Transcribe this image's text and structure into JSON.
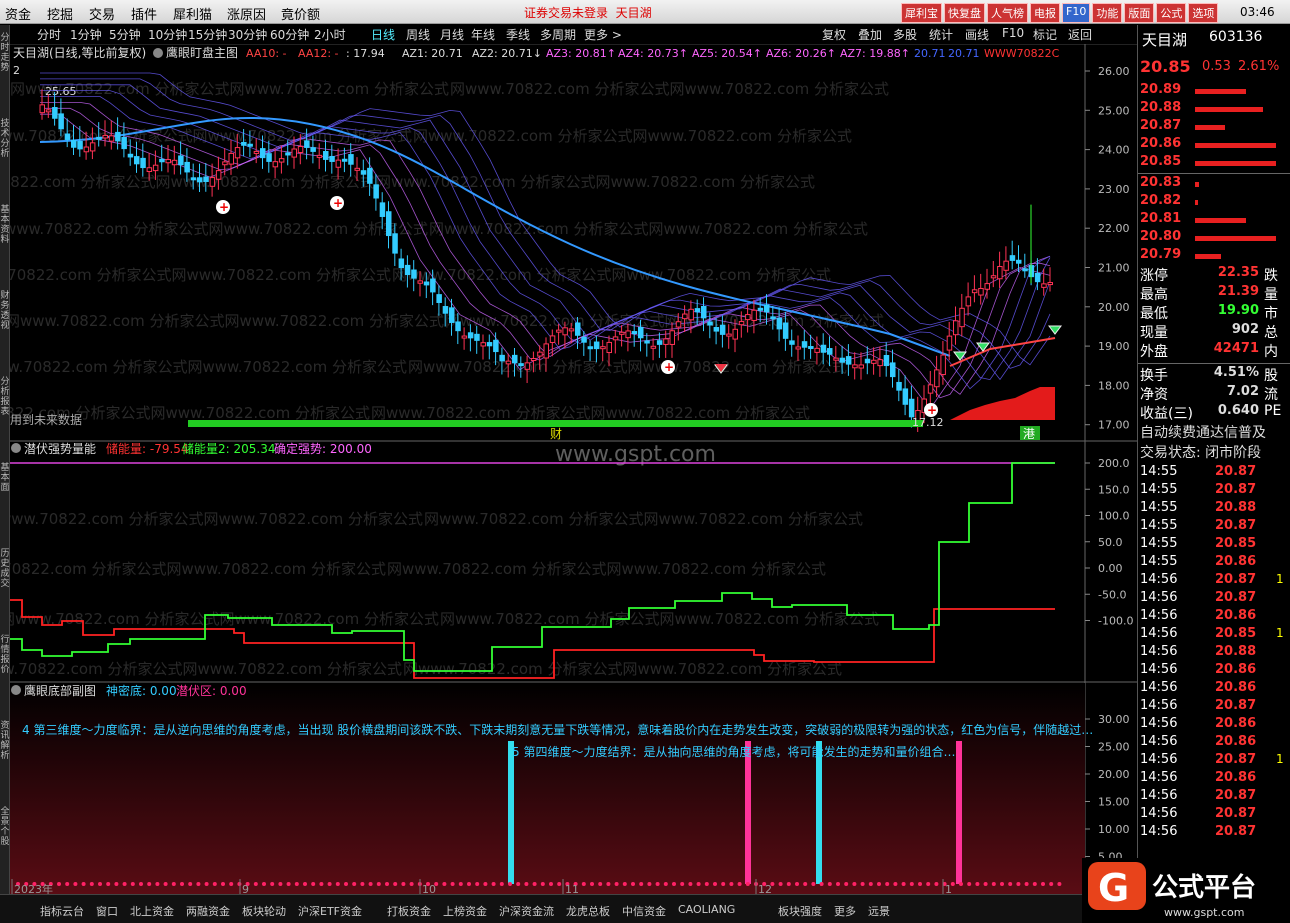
{
  "menu": {
    "items": [
      "资金",
      "挖掘",
      "交易",
      "插件",
      "犀利猫",
      "涨原因",
      "竟价额"
    ],
    "login_status": "证券交易未登录",
    "stock_tag": "天目湖",
    "clock": "03:46"
  },
  "toolbar_buttons": [
    {
      "label": "犀利宝",
      "color": "#cc3333"
    },
    {
      "label": "快复盘",
      "color": "#cc3333"
    },
    {
      "label": "人气榜",
      "color": "#cc3333"
    },
    {
      "label": "电报",
      "color": "#cc3333"
    },
    {
      "label": "F10",
      "color": "#3366cc"
    },
    {
      "label": "功能",
      "color": "#cc3333"
    },
    {
      "label": "版面",
      "color": "#cc3333"
    },
    {
      "label": "公式",
      "color": "#cc3333"
    },
    {
      "label": "选项",
      "color": "#cc3333"
    }
  ],
  "left_nav": [
    "分时走势",
    "技术分析",
    "基本资料",
    "财务透视",
    "分析报表",
    "基本面",
    "历史成交",
    "行情报价",
    "资讯解析",
    "全景个股"
  ],
  "periods": [
    "分时",
    "1分钟",
    "5分钟",
    "10分钟",
    "15分钟",
    "30分钟",
    "60分钟",
    "2小时",
    "日线",
    "周线",
    "月线",
    "年线",
    "季线",
    "多周期",
    "更多 >"
  ],
  "active_period": "日线",
  "right_tools": [
    "复权",
    "叠加",
    "多股",
    "统计",
    "画线",
    "F10",
    "标记",
    "返回"
  ],
  "main_chart": {
    "stock_title": "天目湖(日线,等比前复权)",
    "formula_name": "鹰眼盯盘主图",
    "indicators": [
      {
        "text": "AA10: -",
        "color": "#ff4444"
      },
      {
        "text": "AA12: -",
        "color": "#ff4444"
      },
      {
        "text": ": 17.94",
        "color": "#dddddd"
      },
      {
        "text": "AZ1: 20.71",
        "color": "#dddddd"
      },
      {
        "text": "AZ2: 20.71↓",
        "color": "#dddddd"
      },
      {
        "text": "AZ3: 20.81↑",
        "color": "#ff66ff"
      },
      {
        "text": "AZ4: 20.73↑",
        "color": "#ff66ff"
      },
      {
        "text": "AZ5: 20.54↑",
        "color": "#ff66ff"
      },
      {
        "text": "AZ6: 20.26↑",
        "color": "#ff66ff"
      },
      {
        "text": "AZ7: 19.88↑",
        "color": "#ff66ff"
      },
      {
        "text": "20.71",
        "color": "#4466ff"
      },
      {
        "text": "20.71",
        "color": "#4466ff"
      },
      {
        "text": "WWW70822C",
        "color": "#ff3333"
      }
    ],
    "y_ticks": [
      "26.00",
      "25.00",
      "24.00",
      "23.00",
      "22.00",
      "21.00",
      "20.00",
      "19.00",
      "18.00",
      "17.00"
    ],
    "high_label": "25.65",
    "low_label": "17.12",
    "counter_label": "2",
    "no_future_label": "用到未来数据",
    "marker_cai": "财",
    "marker_gang": "港",
    "watermark": "网www.70822.com 分析家公式网www.70822.com 分析家公式"
  },
  "indicator1": {
    "name": "潜伏强势量能",
    "values": [
      {
        "text": "储能量: -79.54",
        "color": "#ff3333"
      },
      {
        "text": "储能量2: 205.34",
        "color": "#33ff33"
      },
      {
        "text": "确定强势: 200.00",
        "color": "#ff66ff"
      }
    ],
    "y_ticks": [
      "200.0",
      "150.0",
      "100.0",
      "50.0",
      "0.00",
      "-50.0",
      "-100.0"
    ],
    "site_watermark": "www.gspt.com"
  },
  "indicator2": {
    "name": "鹰眼底部副图",
    "values": [
      {
        "text": "神密底: 0.00",
        "color": "#33ccff"
      },
      {
        "text": "潜伏区: 0.00",
        "color": "#ff3399"
      }
    ],
    "note1": "4 第三维度～力度临界：是从逆向思维的角度考虑，当出现 股价横盘期间该跌不跌、下跌末期刻意无量下跌等情况，意味着股价内在走势发生改变，突破弱的极限转为强的状态，红色为信号，伴随越过…",
    "note2": "5 第四维度～力度结界：是从抽向思维的角度考虑，将可能发生的走势和量价组合…",
    "y_ticks": [
      "30.00",
      "25.00",
      "20.00",
      "15.00",
      "10.00",
      "5.00"
    ],
    "date_labels": [
      "2023年",
      "9",
      "10",
      "11",
      "12",
      "1"
    ]
  },
  "quote": {
    "name": "天目湖",
    "code": "603136",
    "price": "20.85",
    "change": "0.53",
    "pct": "2.61%",
    "asks": [
      {
        "p": "20.89",
        "w": 0.6
      },
      {
        "p": "20.88",
        "w": 0.8
      },
      {
        "p": "20.87",
        "w": 0.35
      },
      {
        "p": "20.86",
        "w": 0.95
      },
      {
        "p": "20.85",
        "w": 0.95
      }
    ],
    "bids": [
      {
        "p": "20.83",
        "w": 0.05
      },
      {
        "p": "20.82",
        "w": 0.04
      },
      {
        "p": "20.81",
        "w": 0.6
      },
      {
        "p": "20.80",
        "w": 0.95
      },
      {
        "p": "20.79",
        "w": 0.3
      }
    ],
    "stats": [
      {
        "label": "涨停",
        "value": "22.35",
        "color": "#ff3333",
        "extra": "跌"
      },
      {
        "label": "最高",
        "value": "21.39",
        "color": "#ff3333",
        "extra": "量"
      },
      {
        "label": "最低",
        "value": "19.90",
        "color": "#33ff33",
        "extra": "市"
      },
      {
        "label": "现量",
        "value": "902",
        "color": "#dddddd",
        "extra": "总"
      },
      {
        "label": "外盘",
        "value": "42471",
        "color": "#ff3333",
        "extra": "内"
      },
      {
        "label": "换手",
        "value": "4.51%",
        "color": "#dddddd",
        "extra": "股"
      },
      {
        "label": "净资",
        "value": "7.02",
        "color": "#dddddd",
        "extra": "流"
      },
      {
        "label": "收益(三)",
        "value": "0.640",
        "color": "#dddddd",
        "extra": "PE"
      }
    ],
    "notice": "自动续费通达信普及",
    "trade_state": "交易状态: 闭市阶段",
    "ticks": [
      {
        "t": "14:55",
        "p": "20.87",
        "v": ""
      },
      {
        "t": "14:55",
        "p": "20.87",
        "v": ""
      },
      {
        "t": "14:55",
        "p": "20.88",
        "v": ""
      },
      {
        "t": "14:55",
        "p": "20.87",
        "v": ""
      },
      {
        "t": "14:55",
        "p": "20.85",
        "v": ""
      },
      {
        "t": "14:55",
        "p": "20.86",
        "v": ""
      },
      {
        "t": "14:56",
        "p": "20.87",
        "v": "1"
      },
      {
        "t": "14:56",
        "p": "20.87",
        "v": ""
      },
      {
        "t": "14:56",
        "p": "20.86",
        "v": ""
      },
      {
        "t": "14:56",
        "p": "20.85",
        "v": "1"
      },
      {
        "t": "14:56",
        "p": "20.88",
        "v": ""
      },
      {
        "t": "14:56",
        "p": "20.86",
        "v": ""
      },
      {
        "t": "14:56",
        "p": "20.86",
        "v": ""
      },
      {
        "t": "14:56",
        "p": "20.87",
        "v": ""
      },
      {
        "t": "14:56",
        "p": "20.86",
        "v": ""
      },
      {
        "t": "14:56",
        "p": "20.86",
        "v": ""
      },
      {
        "t": "14:56",
        "p": "20.87",
        "v": "1"
      },
      {
        "t": "14:56",
        "p": "20.86",
        "v": ""
      },
      {
        "t": "14:56",
        "p": "20.87",
        "v": ""
      },
      {
        "t": "14:56",
        "p": "20.87",
        "v": ""
      },
      {
        "t": "14:56",
        "p": "20.87",
        "v": ""
      }
    ]
  },
  "bottom_tabs": [
    "指标云台",
    "窗口",
    "北上资金",
    "两融资金",
    "板块轮动",
    "沪深ETF资金",
    "打板资金",
    "上榜资金",
    "沪深资金流",
    "龙虎总板",
    "中信资金",
    "CAOLIANG",
    "板块强度",
    "更多",
    "远景"
  ],
  "logo_text": "公式平台",
  "logo_url": "www.gspt.com",
  "colors": {
    "up": "#ff3355",
    "down": "#33ccff",
    "ma_slow": "#3399ff",
    "green_line": "#33ff33",
    "red_line": "#ff2222"
  }
}
